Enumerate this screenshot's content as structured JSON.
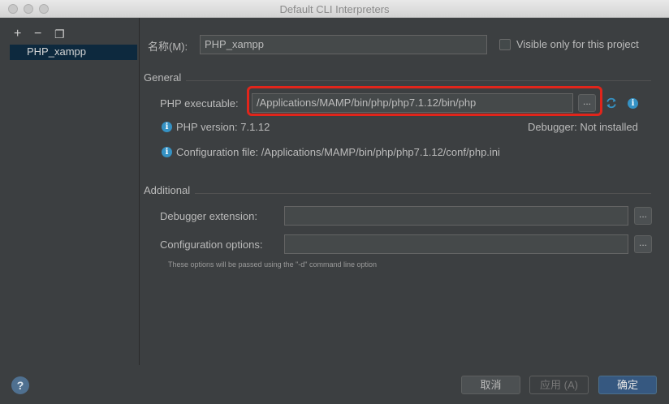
{
  "window": {
    "title": "Default CLI Interpreters"
  },
  "toolbar": {
    "add": "+",
    "remove": "−",
    "copy": "❐"
  },
  "interpreters": [
    {
      "label": "PHP_xampp",
      "selected": true
    }
  ],
  "name_row": {
    "label": "名称(M):",
    "value": "PHP_xampp",
    "visible_only_label": "Visible only for this project",
    "visible_only_checked": false
  },
  "general": {
    "title": "General",
    "php_executable_label": "PHP executable:",
    "php_executable_value": "/Applications/MAMP/bin/php/php7.1.12/bin/php",
    "browse": "...",
    "php_version": "PHP version: 7.1.12",
    "debugger": "Debugger: Not installed",
    "config_file": "Configuration file: /Applications/MAMP/bin/php/php7.1.12/conf/php.ini"
  },
  "additional": {
    "title": "Additional",
    "debugger_extension_label": "Debugger extension:",
    "debugger_extension_value": "",
    "configuration_options_label": "Configuration options:",
    "configuration_options_value": "",
    "browse": "...",
    "hint": "These options will be passed using the \"-d\" command line option"
  },
  "buttons": {
    "cancel": "取消",
    "apply": "应用 (A)",
    "ok": "确定",
    "help": "?"
  },
  "colors": {
    "accent": "#365880",
    "highlight": "#e1251b",
    "info": "#3592c4",
    "selection": "#0d293e"
  }
}
